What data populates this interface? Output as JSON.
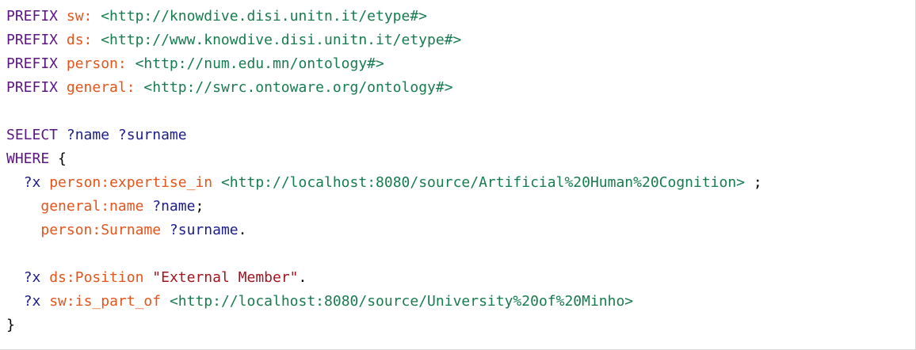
{
  "editor": {
    "lines": [
      [
        {
          "t": "PREFIX ",
          "c": "kw"
        },
        {
          "t": "sw:",
          "c": "pfx"
        },
        {
          "t": " ",
          "c": "pun"
        },
        {
          "t": "<http://knowdive.disi.unitn.it/etype#>",
          "c": "uri"
        }
      ],
      [
        {
          "t": "PREFIX ",
          "c": "kw"
        },
        {
          "t": "ds:",
          "c": "pfx"
        },
        {
          "t": " ",
          "c": "pun"
        },
        {
          "t": "<http://www.knowdive.disi.unitn.it/etype#>",
          "c": "uri"
        }
      ],
      [
        {
          "t": "PREFIX ",
          "c": "kw"
        },
        {
          "t": "person:",
          "c": "pfx"
        },
        {
          "t": " ",
          "c": "pun"
        },
        {
          "t": "<http://num.edu.mn/ontology#>",
          "c": "uri"
        }
      ],
      [
        {
          "t": "PREFIX ",
          "c": "kw"
        },
        {
          "t": "general:",
          "c": "pfx"
        },
        {
          "t": " ",
          "c": "pun"
        },
        {
          "t": "<http://swrc.ontoware.org/ontology#>",
          "c": "uri"
        }
      ],
      [],
      [
        {
          "t": "SELECT ",
          "c": "kw"
        },
        {
          "t": "?name",
          "c": "var"
        },
        {
          "t": " ",
          "c": "pun"
        },
        {
          "t": "?surname",
          "c": "var"
        }
      ],
      [
        {
          "t": "WHERE ",
          "c": "kw"
        },
        {
          "t": "{",
          "c": "pun"
        }
      ],
      [
        {
          "t": "  ",
          "c": "pun"
        },
        {
          "t": "?x",
          "c": "var"
        },
        {
          "t": " ",
          "c": "pun"
        },
        {
          "t": "person:expertise_in",
          "c": "pfx"
        },
        {
          "t": " ",
          "c": "pun"
        },
        {
          "t": "<http://localhost:8080/source/Artificial%20Human%20Cognition>",
          "c": "uri"
        },
        {
          "t": " ;",
          "c": "pun"
        }
      ],
      [
        {
          "t": "    ",
          "c": "pun"
        },
        {
          "t": "general:name",
          "c": "pfx"
        },
        {
          "t": " ",
          "c": "pun"
        },
        {
          "t": "?name",
          "c": "var"
        },
        {
          "t": ";",
          "c": "pun"
        }
      ],
      [
        {
          "t": "    ",
          "c": "pun"
        },
        {
          "t": "person:Surname",
          "c": "pfx"
        },
        {
          "t": " ",
          "c": "pun"
        },
        {
          "t": "?surname",
          "c": "var"
        },
        {
          "t": ".",
          "c": "pun"
        }
      ],
      [],
      [
        {
          "t": "  ",
          "c": "pun"
        },
        {
          "t": "?x",
          "c": "var"
        },
        {
          "t": " ",
          "c": "pun"
        },
        {
          "t": "ds:Position",
          "c": "pfx"
        },
        {
          "t": " ",
          "c": "pun"
        },
        {
          "t": "\"External Member\"",
          "c": "str"
        },
        {
          "t": ".",
          "c": "pun"
        }
      ],
      [
        {
          "t": "  ",
          "c": "pun"
        },
        {
          "t": "?x",
          "c": "var"
        },
        {
          "t": " ",
          "c": "pun"
        },
        {
          "t": "sw:is_part_of",
          "c": "pfx"
        },
        {
          "t": " ",
          "c": "pun"
        },
        {
          "t": "<http://localhost:8080/source/University%20of%20Minho>",
          "c": "uri"
        }
      ],
      [
        {
          "t": "}",
          "c": "pun"
        }
      ]
    ]
  },
  "colors": {
    "keyword": "#5c1683",
    "prefixed_name": "#e4541b",
    "iri": "#167c4f",
    "variable": "#1b1c8c",
    "string": "#a2141e",
    "punctuation": "#000000",
    "background": "#ffffff"
  }
}
